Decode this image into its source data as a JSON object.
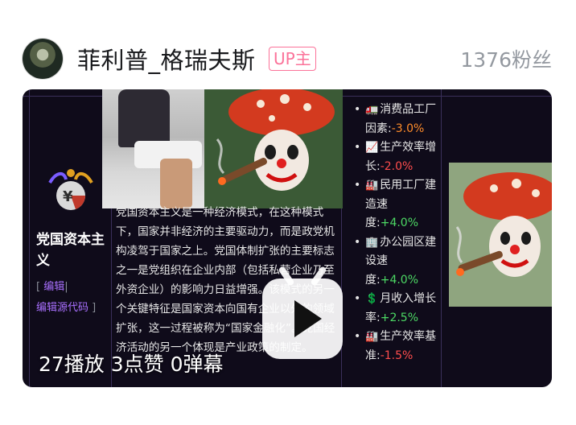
{
  "header": {
    "username": "菲利普_格瑞夫斯",
    "badge": "UP主",
    "fans": "1376粉丝"
  },
  "card": {
    "title": "党国资本主义",
    "edit": {
      "open": "[ ",
      "edit_label": "编辑",
      "sep": "|",
      "source_label": "编辑源代码",
      "close": " ]"
    },
    "body": "党国资本主义是一种经济模式，在这种模式下，国家并非经济的主要驱动力，而是政党机构凌驾于国家之上。党国体制扩张的主要标志之一是党组织在企业内部（包括私营企业乃至外资企业）的影响力日益增强。该模式的另一个关键特征是国家资本向国有企业以外的领域扩张，这一过程被称为“国家金融化”。党国经济活动的另一个体现是产业政策的制定。",
    "stats": [
      {
        "icon": "🚛",
        "label": "消费品工厂因素:",
        "value": "-3.0%",
        "tone": "neg"
      },
      {
        "icon": "📈",
        "label": "生产效率增长:",
        "value": "-2.0%",
        "tone": "neg2"
      },
      {
        "icon": "🏭",
        "label": "民用工厂建造速度:",
        "value": "+4.0%",
        "tone": "pos"
      },
      {
        "icon": "🏢",
        "label": "办公园区建设速度:",
        "value": "+4.0%",
        "tone": "pos"
      },
      {
        "icon": "💲",
        "label": "月收入增长率:",
        "value": "+2.5%",
        "tone": "pos"
      },
      {
        "icon": "🏭",
        "label": "生产效率基准:",
        "value": "-1.5%",
        "tone": "neg2"
      }
    ],
    "overlay": "27播放  3点赞  0弹幕"
  }
}
